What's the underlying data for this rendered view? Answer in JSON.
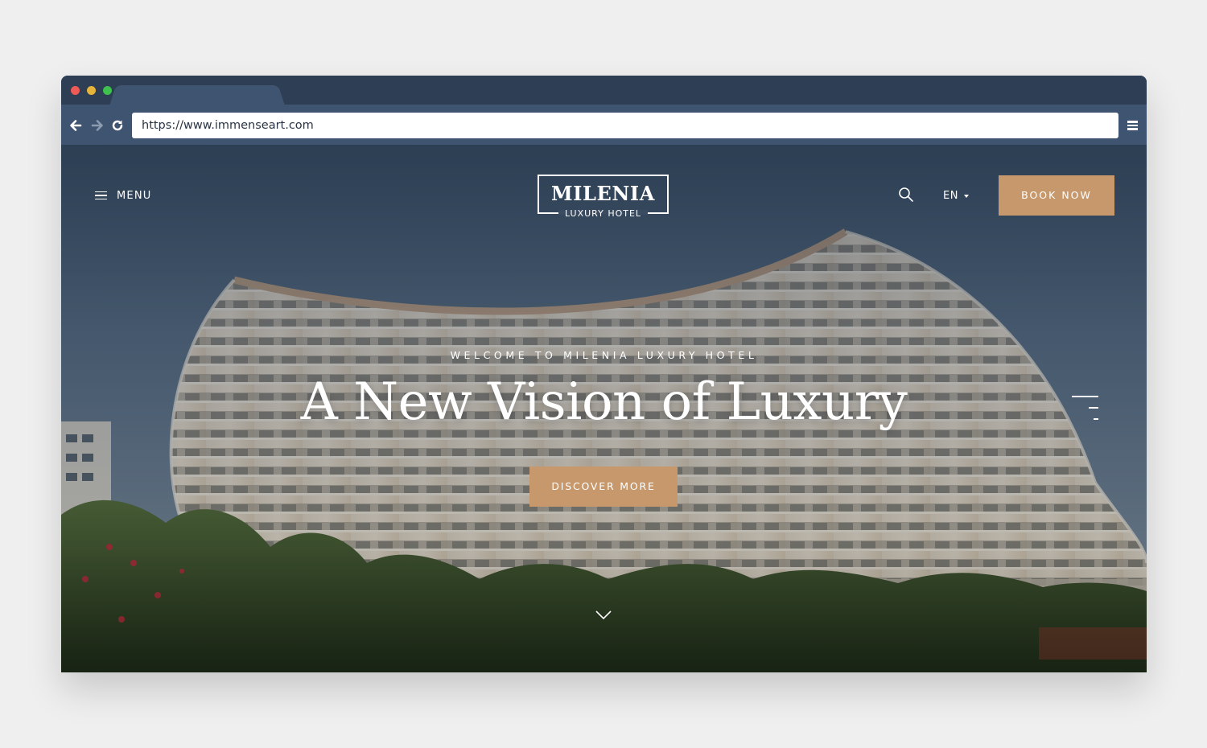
{
  "browser": {
    "url": "https://www.immenseart.com",
    "icons": [
      "back-arrow-icon",
      "forward-arrow-icon",
      "reload-icon",
      "hamburger-menu-icon"
    ]
  },
  "site": {
    "menu_label": "MENU",
    "logo": {
      "name": "MILENIA",
      "tagline": "LUXURY HOTEL"
    },
    "language": "EN",
    "book_button": "BOOK NOW"
  },
  "hero": {
    "welcome": "WELCOME TO MILENIA LUXURY HOTEL",
    "headline": "A New Vision of Luxury",
    "cta": "DISCOVER MORE"
  },
  "colors": {
    "accent": "#c6986c",
    "browser_chrome": "#2e3e54",
    "toolbar": "#3f5470",
    "page_bg": "#efefef"
  }
}
